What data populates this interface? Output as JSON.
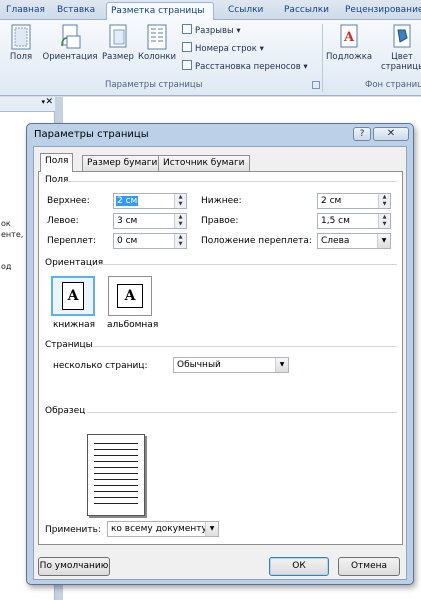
{
  "ribbon": {
    "tabs": [
      "Главная",
      "Вставка",
      "Разметка страницы",
      "Ссылки",
      "Рассылки",
      "Рецензирование"
    ],
    "active_tab": "Разметка страницы",
    "buttons": {
      "margins": "Поля",
      "orientation": "Ориентация",
      "size": "Размер",
      "columns": "Колонки",
      "breaks": "Разрывы",
      "line_numbers": "Номера строк",
      "hyphenation": "Расстановка переносов",
      "watermark": "Подложка",
      "page_color_line1": "Цвет",
      "page_color_line2": "страницы"
    },
    "group_labels": {
      "page_setup": "Параметры страницы",
      "page_background": "Фон страниц"
    }
  },
  "doc_fragments": [
    "ок",
    "енте,",
    "од"
  ],
  "dialog": {
    "title": "Параметры страницы",
    "help": "?",
    "close": "✕",
    "tabs": [
      "Поля",
      "Размер бумаги",
      "Источник бумаги"
    ],
    "active_tab": "Поля",
    "margins_section": "Поля",
    "fields": {
      "top_label": "Верхнее:",
      "top_value": "2 см",
      "bottom_label": "Нижнее:",
      "bottom_value": "2 см",
      "left_label": "Левое:",
      "left_value": "3 см",
      "right_label": "Правое:",
      "right_value": "1,5 см",
      "gutter_label": "Переплет:",
      "gutter_value": "0 см",
      "gutter_pos_label": "Положение переплета:",
      "gutter_pos_value": "Слева"
    },
    "orientation_section": "Ориентация",
    "orientation": {
      "portrait": "книжная",
      "landscape": "альбомная",
      "glyph": "A",
      "selected": "portrait"
    },
    "pages_section": "Страницы",
    "pages": {
      "multiple_label": "несколько страниц:",
      "multiple_value": "Обычный"
    },
    "sample_section": "Образец",
    "apply_label": "Применить:",
    "apply_value": "ко всему документу",
    "buttons": {
      "default": "По умолчанию",
      "ok": "ОК",
      "cancel": "Отмена"
    }
  }
}
